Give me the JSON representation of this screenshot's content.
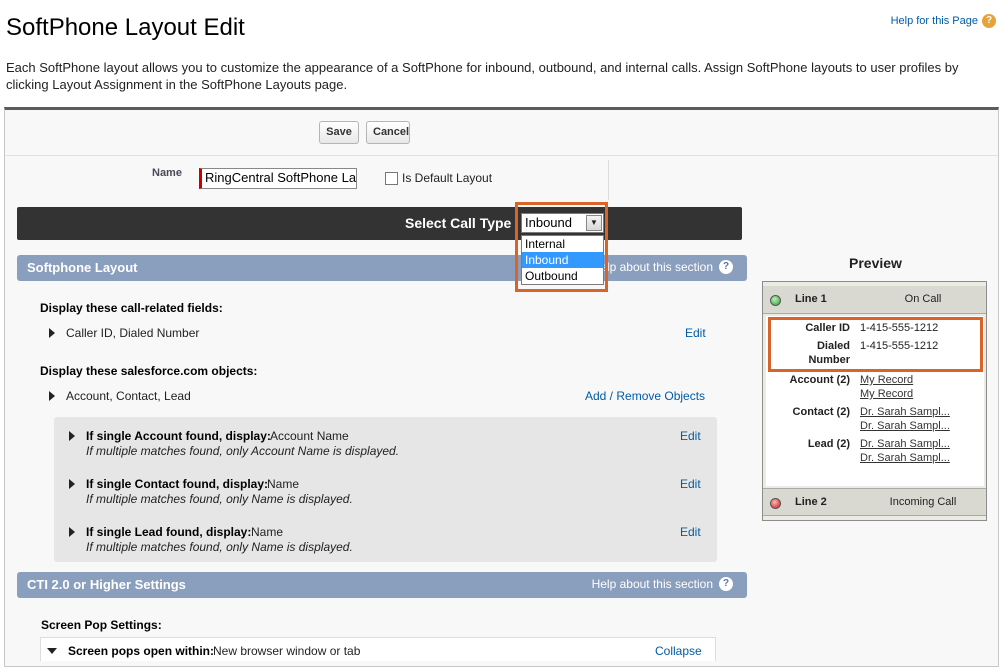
{
  "page": {
    "title": "SoftPhone Layout Edit",
    "help_link": "Help for this Page",
    "description": "Each SoftPhone layout allows you to customize the appearance of a SoftPhone for inbound, outbound, and internal calls. Assign SoftPhone layouts to user profiles by clicking Layout Assignment in the SoftPhone Layouts page."
  },
  "buttons": {
    "save": "Save",
    "cancel": "Cancel"
  },
  "form": {
    "name_label": "Name",
    "name_value": "RingCentral SoftPhone La",
    "default_label": "Is Default Layout",
    "default_checked": false
  },
  "call_type": {
    "label": "Select Call Type",
    "selected": "Inbound",
    "options": [
      "Internal",
      "Inbound",
      "Outbound"
    ]
  },
  "softphone_section": {
    "title": "Softphone Layout",
    "help": "Help about this section",
    "fields_heading": "Display these call-related fields:",
    "fields_value": "Caller ID, Dialed Number",
    "fields_edit": "Edit",
    "objects_heading": "Display these salesforce.com objects:",
    "objects_value": "Account, Contact, Lead",
    "objects_action": "Add / Remove Objects",
    "object_rules": [
      {
        "label": "If single Account found, display:",
        "value": "Account Name",
        "note": "If multiple matches found, only Account Name is displayed.",
        "edit": "Edit"
      },
      {
        "label": "If single Contact found, display:",
        "value": "Name",
        "note": "If multiple matches found, only Name is displayed.",
        "edit": "Edit"
      },
      {
        "label": "If single Lead found, display:",
        "value": "Name",
        "note": "If multiple matches found, only Name is displayed.",
        "edit": "Edit"
      }
    ]
  },
  "cti_section": {
    "title": "CTI 2.0 or Higher Settings",
    "help": "Help about this section",
    "screen_pop_heading": "Screen Pop Settings:",
    "screen_pop_label": "Screen pops open within:",
    "screen_pop_value": "New browser window or tab",
    "collapse": "Collapse"
  },
  "preview": {
    "title": "Preview",
    "line1": {
      "label": "Line 1",
      "status": "On Call"
    },
    "caller_id_label": "Caller ID",
    "caller_id_value": "1-415-555-1212",
    "dialed_label_1": "Dialed",
    "dialed_label_2": "Number",
    "dialed_value": "1-415-555-1212",
    "account_label": "Account (2)",
    "account_links": [
      "My Record",
      "My Record"
    ],
    "contact_label": "Contact (2)",
    "contact_links": [
      "Dr. Sarah Sampl...",
      "Dr. Sarah Sampl..."
    ],
    "lead_label": "Lead (2)",
    "lead_links": [
      "Dr. Sarah Sampl...",
      "Dr. Sarah Sampl..."
    ],
    "line2": {
      "label": "Line 2",
      "status": "Incoming Call"
    }
  },
  "colors": {
    "section_header": "#8a9ebe",
    "call_type_bar": "#333333",
    "highlight": "#d9642a",
    "link": "#015ba7"
  }
}
